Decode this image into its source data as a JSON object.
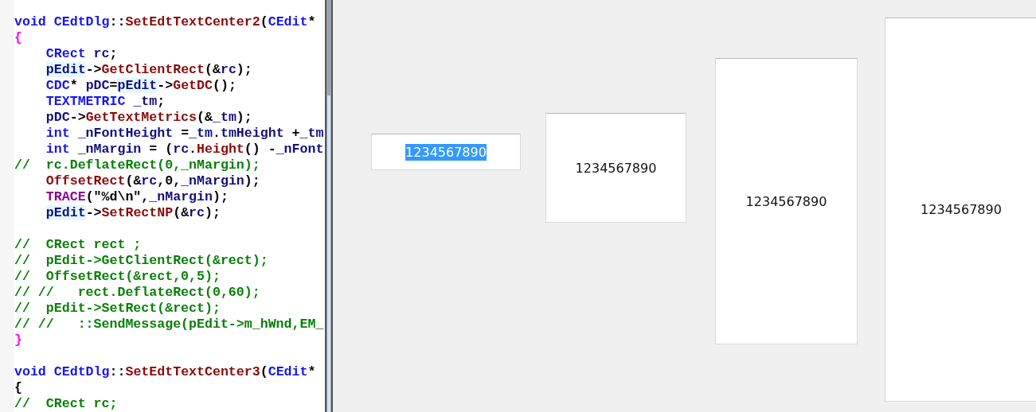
{
  "code_editor": {
    "lines": [
      {
        "kind": "code",
        "indented": false,
        "tokens": [
          {
            "kind": "type",
            "text": "void CEdtDlg"
          },
          {
            "kind": "punct",
            "text": "::"
          },
          {
            "kind": "func",
            "text": "SetEdtTextCenter2"
          },
          {
            "kind": "punct",
            "text": "("
          },
          {
            "kind": "type",
            "text": "CEdit"
          },
          {
            "kind": "punct",
            "text": "*"
          }
        ]
      },
      {
        "kind": "code",
        "indented": false,
        "tokens": [
          {
            "kind": "brace",
            "text": "{"
          }
        ]
      },
      {
        "kind": "code",
        "indented": true,
        "tokens": [
          {
            "kind": "type",
            "text": "CRect"
          },
          {
            "kind": "var",
            "text": " rc"
          },
          {
            "kind": "punct",
            "text": ";"
          }
        ]
      },
      {
        "kind": "code",
        "indented": true,
        "tokens": [
          {
            "kind": "ref",
            "text": "pEdit"
          },
          {
            "kind": "punct",
            "text": "->"
          },
          {
            "kind": "func",
            "text": "GetClientRect"
          },
          {
            "kind": "punct",
            "text": "(&"
          },
          {
            "kind": "var",
            "text": "rc"
          },
          {
            "kind": "punct",
            "text": ");"
          }
        ]
      },
      {
        "kind": "code",
        "indented": true,
        "tokens": [
          {
            "kind": "type",
            "text": "CDC"
          },
          {
            "kind": "punct",
            "text": "* "
          },
          {
            "kind": "var",
            "text": "pDC"
          },
          {
            "kind": "punct",
            "text": "="
          },
          {
            "kind": "ref",
            "text": "pEdit"
          },
          {
            "kind": "punct",
            "text": "->"
          },
          {
            "kind": "func",
            "text": "GetDC"
          },
          {
            "kind": "punct",
            "text": "();"
          }
        ]
      },
      {
        "kind": "code",
        "indented": true,
        "tokens": [
          {
            "kind": "type",
            "text": "TEXTMETRIC"
          },
          {
            "kind": "var",
            "text": " _tm"
          },
          {
            "kind": "punct",
            "text": ";"
          }
        ]
      },
      {
        "kind": "code",
        "indented": true,
        "tokens": [
          {
            "kind": "var",
            "text": "pDC"
          },
          {
            "kind": "punct",
            "text": "->"
          },
          {
            "kind": "func",
            "text": "GetTextMetrics"
          },
          {
            "kind": "punct",
            "text": "(&"
          },
          {
            "kind": "var",
            "text": "_tm"
          },
          {
            "kind": "punct",
            "text": ");"
          }
        ]
      },
      {
        "kind": "code",
        "indented": true,
        "tokens": [
          {
            "kind": "type",
            "text": "int"
          },
          {
            "kind": "var",
            "text": " _nFontHeight "
          },
          {
            "kind": "punct",
            "text": "="
          },
          {
            "kind": "var",
            "text": "_tm"
          },
          {
            "kind": "punct",
            "text": "."
          },
          {
            "kind": "var",
            "text": "tmHeight "
          },
          {
            "kind": "punct",
            "text": "+"
          },
          {
            "kind": "var",
            "text": "_tm"
          }
        ]
      },
      {
        "kind": "code",
        "indented": true,
        "tokens": [
          {
            "kind": "type",
            "text": "int"
          },
          {
            "kind": "var",
            "text": " _nMargin "
          },
          {
            "kind": "punct",
            "text": "= ("
          },
          {
            "kind": "var",
            "text": "rc"
          },
          {
            "kind": "punct",
            "text": "."
          },
          {
            "kind": "func",
            "text": "Height"
          },
          {
            "kind": "punct",
            "text": "() -"
          },
          {
            "kind": "var",
            "text": "_nFont"
          }
        ]
      },
      {
        "kind": "code",
        "indented": false,
        "tokens": [
          {
            "kind": "comment",
            "text": "//  rc.DeflateRect(0,_nMargin);"
          }
        ]
      },
      {
        "kind": "code",
        "indented": true,
        "tokens": [
          {
            "kind": "func",
            "text": "OffsetRect"
          },
          {
            "kind": "punct",
            "text": "(&"
          },
          {
            "kind": "var",
            "text": "rc"
          },
          {
            "kind": "punct",
            "text": ",0,"
          },
          {
            "kind": "var",
            "text": "_nMargin"
          },
          {
            "kind": "punct",
            "text": ");"
          }
        ]
      },
      {
        "kind": "code",
        "indented": true,
        "tokens": [
          {
            "kind": "macro",
            "text": "TRACE"
          },
          {
            "kind": "punct",
            "text": "(\"%d\\n\","
          },
          {
            "kind": "var",
            "text": "_nMargin"
          },
          {
            "kind": "punct",
            "text": ");"
          }
        ]
      },
      {
        "kind": "code",
        "indented": true,
        "tokens": [
          {
            "kind": "ref",
            "text": "pEdit"
          },
          {
            "kind": "punct",
            "text": "->"
          },
          {
            "kind": "func",
            "text": "SetRectNP"
          },
          {
            "kind": "punct",
            "text": "(&"
          },
          {
            "kind": "var",
            "text": "rc"
          },
          {
            "kind": "punct",
            "text": ");"
          }
        ]
      },
      {
        "kind": "blank"
      },
      {
        "kind": "code",
        "indented": false,
        "tokens": [
          {
            "kind": "comment",
            "text": "//  CRect rect ;"
          }
        ]
      },
      {
        "kind": "code",
        "indented": false,
        "tokens": [
          {
            "kind": "comment",
            "text": "//  pEdit->GetClientRect(&rect);"
          }
        ]
      },
      {
        "kind": "code",
        "indented": false,
        "tokens": [
          {
            "kind": "comment",
            "text": "//  OffsetRect(&rect,0,5);"
          }
        ]
      },
      {
        "kind": "code",
        "indented": false,
        "tokens": [
          {
            "kind": "comment",
            "text": "// //   rect.DeflateRect(0,60);"
          }
        ]
      },
      {
        "kind": "code",
        "indented": false,
        "tokens": [
          {
            "kind": "comment",
            "text": "//  pEdit->SetRect(&rect);"
          }
        ]
      },
      {
        "kind": "code",
        "indented": false,
        "tokens": [
          {
            "kind": "comment",
            "text": "// //   ::SendMessage(pEdit->m_hWnd,EM_"
          }
        ]
      },
      {
        "kind": "code",
        "indented": false,
        "tokens": [
          {
            "kind": "brace",
            "text": "}"
          }
        ]
      },
      {
        "kind": "blank"
      },
      {
        "kind": "code",
        "indented": false,
        "tokens": [
          {
            "kind": "type",
            "text": "void CEdtDlg"
          },
          {
            "kind": "punct",
            "text": "::"
          },
          {
            "kind": "func",
            "text": "SetEdtTextCenter3"
          },
          {
            "kind": "punct",
            "text": "("
          },
          {
            "kind": "type",
            "text": "CEdit"
          },
          {
            "kind": "punct",
            "text": "*"
          }
        ]
      },
      {
        "kind": "code",
        "indented": false,
        "tokens": [
          {
            "kind": "punct",
            "text": "{"
          }
        ]
      },
      {
        "kind": "code",
        "indented": false,
        "tokens": [
          {
            "kind": "comment",
            "text": "//  CRect rc;"
          }
        ]
      }
    ]
  },
  "dialog": {
    "edits": [
      {
        "value": "1234567890",
        "text_selected": true
      },
      {
        "value": "1234567890",
        "text_selected": false
      },
      {
        "value": "1234567890",
        "text_selected": false
      },
      {
        "value": "1234567890",
        "text_selected": false
      }
    ]
  }
}
